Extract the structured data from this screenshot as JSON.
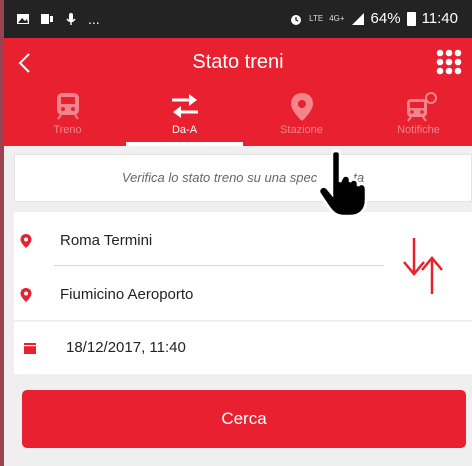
{
  "status_bar": {
    "left_icons": [
      "image-icon",
      "gallery-icon",
      "mic-icon"
    ],
    "more": "...",
    "network": "LTE",
    "network_gen": "4G+",
    "battery": "64%",
    "time": "11:40"
  },
  "app_bar": {
    "title": "Stato treni"
  },
  "tabs": [
    {
      "label": "Treno",
      "icon": "train-icon",
      "active": false
    },
    {
      "label": "Da-A",
      "icon": "swap-arrows-icon",
      "active": true
    },
    {
      "label": "Stazione",
      "icon": "location-pin-icon",
      "active": false
    },
    {
      "label": "Notifiche",
      "icon": "train-notification-icon",
      "active": false
    }
  ],
  "info_text": "Verifica lo stato treno su una spec",
  "info_text_tail": "ta",
  "route": {
    "from": "Roma Termini",
    "to": "Fiumicino Aeroporto"
  },
  "datetime": "18/12/2017, 11:40",
  "search_button": "Cerca",
  "colors": {
    "accent": "#e8202f",
    "status_bar": "#232323",
    "background": "#efefef"
  }
}
